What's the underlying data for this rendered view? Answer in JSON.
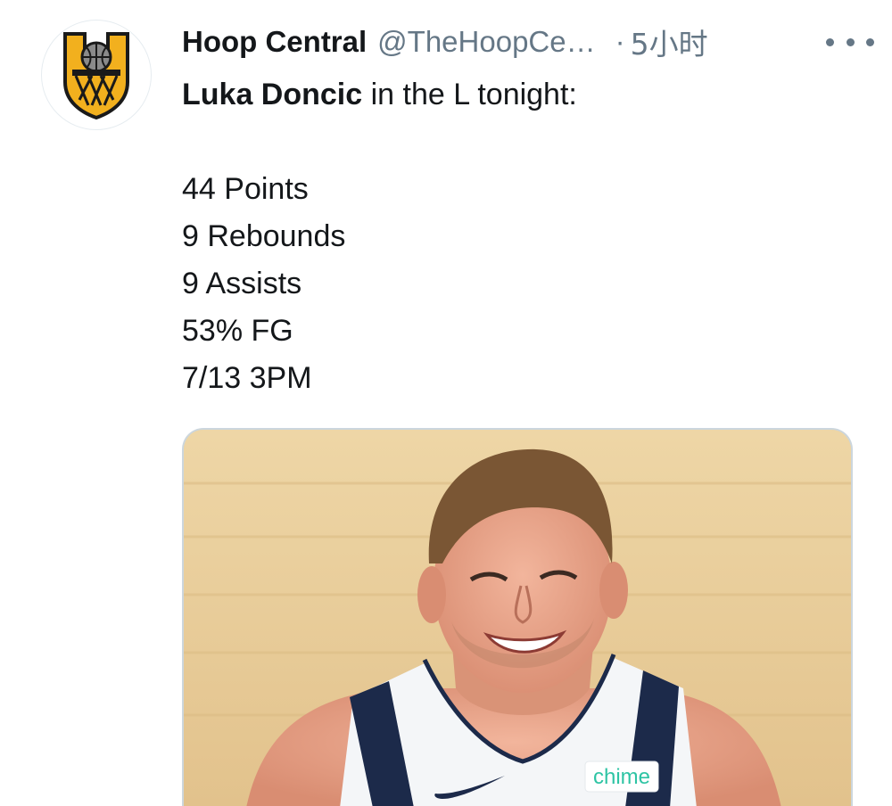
{
  "tweet": {
    "author": {
      "display_name": "Hoop Central",
      "handle": "@TheHoopCe…",
      "avatar_icon": "hoop-central-logo"
    },
    "separator": "·",
    "timestamp": "5小时",
    "more_icon": "more-horizontal-icon",
    "text": {
      "mention": "Luka Doncic",
      "intro_rest": " in the L tonight:",
      "stats": [
        "44 Points",
        "9 Rebounds",
        "9 Assists",
        "53% FG",
        "7/13 3PM"
      ]
    },
    "media": {
      "jersey_sponsor": "chime"
    }
  },
  "colors": {
    "text_primary": "#14171a",
    "text_secondary": "#657786",
    "logo_gold": "#f2b01e",
    "logo_dark": "#1a1a1a",
    "court_wood": "#e9cf9e",
    "jersey_navy": "#1c2a4a",
    "chime_green": "#2ec4a4"
  }
}
